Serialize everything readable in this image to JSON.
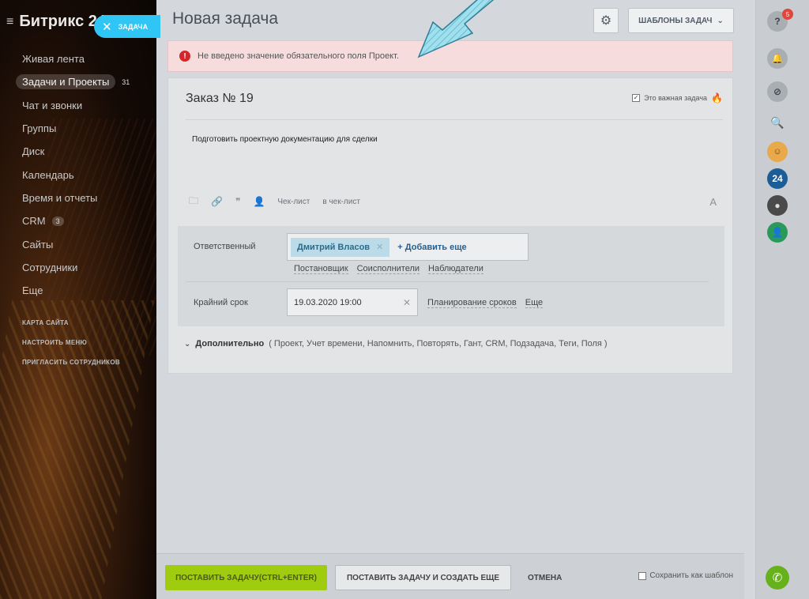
{
  "sidebar": {
    "brand": "Битрикс 24",
    "task_pill": "ЗАДАЧА",
    "items": [
      {
        "label": "Живая лента",
        "count": ""
      },
      {
        "label": "Задачи и Проекты",
        "count": "31"
      },
      {
        "label": "Чат и звонки",
        "count": ""
      },
      {
        "label": "Группы",
        "count": ""
      },
      {
        "label": "Диск",
        "count": ""
      },
      {
        "label": "Календарь",
        "count": ""
      },
      {
        "label": "Время и отчеты",
        "count": ""
      },
      {
        "label": "CRM",
        "count": "3"
      },
      {
        "label": "Сайты",
        "count": ""
      },
      {
        "label": "Сотрудники",
        "count": ""
      },
      {
        "label": "Еще",
        "count": ""
      }
    ],
    "small_links": [
      "КАРТА САЙТА",
      "НАСТРОИТЬ МЕНЮ",
      "ПРИГЛАСИТЬ СОТРУДНИКОВ"
    ]
  },
  "header": {
    "title": "Новая задача",
    "templates_label": "ШАБЛОНЫ ЗАДАЧ"
  },
  "error": {
    "text": "Не введено значение обязательного поля Проект."
  },
  "task": {
    "title": "Заказ № 19",
    "important_label": "Это важная задача",
    "description": "Подготовить проектную документацию для сделки",
    "toolbar": {
      "checklist": "Чек-лист",
      "to_checklist": "в чек-лист",
      "font": "A"
    }
  },
  "fields": {
    "responsible_label": "Ответственный",
    "responsible_person": "Дмитрий Власов",
    "add_more": "+ Добавить еще",
    "sub_links": [
      "Постановщик",
      "Соисполнители",
      "Наблюдатели"
    ],
    "deadline_label": "Крайний срок",
    "deadline_value": "19.03.2020 19:00",
    "deadline_links": [
      "Планирование сроков",
      "Еще"
    ]
  },
  "extra": {
    "label": "Дополнительно",
    "items": "( Проект,  Учет времени,  Напомнить,  Повторять,  Гант,  CRM,  Подзадача,  Теги,  Поля )"
  },
  "footer": {
    "submit": "ПОСТАВИТЬ ЗАДАЧУ(CTRL+ENTER)",
    "submit_more": "ПОСТАВИТЬ ЗАДАЧУ И СОЗДАТЬ ЕЩЕ",
    "cancel": "ОТМЕНА",
    "save_template": "Сохранить как шаблон"
  },
  "rightbar": {
    "help_badge": "5",
    "b24_label": "24"
  },
  "colors": {
    "accent_blue": "#2fc6f6",
    "submit_green": "#9fcc0f",
    "error_red": "#d4272b",
    "error_bg": "#f6dcdc"
  }
}
